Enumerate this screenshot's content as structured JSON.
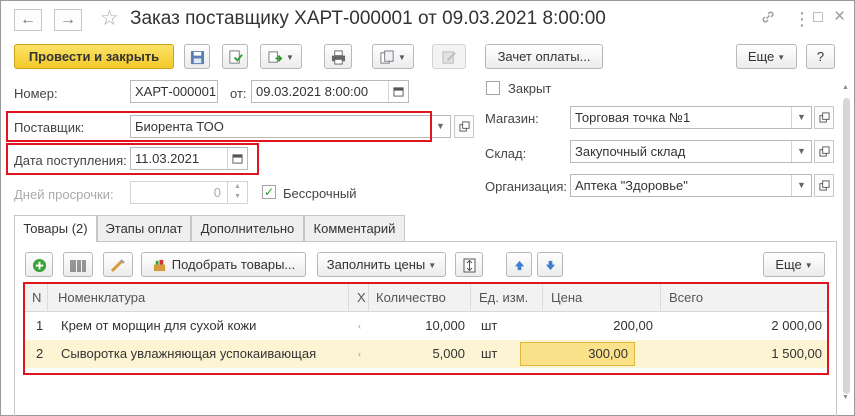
{
  "window": {
    "title": "Заказ поставщику ХАРТ-000001 от 09.03.2021 8:00:00",
    "back_glyph": "←",
    "forward_glyph": "→",
    "star_glyph": "☆",
    "link_glyph": "🔗",
    "menu_glyph": "⋮",
    "maximize_glyph": "□",
    "close_glyph": "×"
  },
  "toolbar": {
    "post_close_label": "Провести и закрыть",
    "payment_offset_label": "Зачет оплаты...",
    "more_label": "Еще",
    "help_label": "?"
  },
  "form": {
    "number_label": "Номер:",
    "number_value": "ХАРТ-000001",
    "date_from_label": "от:",
    "date_value": "09.03.2021  8:00:00",
    "supplier_label": "Поставщик:",
    "supplier_value": "Биорента ТОО",
    "arrival_label": "Дата поступления:",
    "arrival_value": "11.03.2021",
    "overdue_label": "Дней просрочки:",
    "overdue_value": "0",
    "unlimited_label": "Бессрочный",
    "unlimited_checked": true,
    "closed_label": "Закрыт",
    "closed_checked": false,
    "store_label": "Магазин:",
    "store_value": "Торговая точка №1",
    "warehouse_label": "Склад:",
    "warehouse_value": "Закупочный склад",
    "org_label": "Организация:",
    "org_value": "Аптека \"Здоровье\""
  },
  "tabs": [
    {
      "label": "Товары (2)",
      "active": true
    },
    {
      "label": "Этапы оплат",
      "active": false
    },
    {
      "label": "Дополнительно",
      "active": false
    },
    {
      "label": "Комментарий",
      "active": false
    }
  ],
  "table_toolbar": {
    "pick_label": "Подобрать товары...",
    "fill_prices_label": "Заполнить цены",
    "more_label": "Еще"
  },
  "table": {
    "columns": [
      "N",
      "Номенклатура",
      "Х",
      "Количество",
      "Ед. изм.",
      "Цена",
      "Всего"
    ],
    "rows": [
      {
        "n": "1",
        "name": "Крем от морщин для сухой кожи",
        "qty": "10,000",
        "unit": "шт",
        "price": "200,00",
        "total": "2 000,00"
      },
      {
        "n": "2",
        "name": "Сыворотка увлажняющая успокаивающая",
        "qty": "5,000",
        "unit": "шт",
        "price": "300,00",
        "total": "1 500,00"
      }
    ]
  },
  "colors": {
    "accent_yellow": "#f3c92a",
    "selected_row": "#fcf4d2",
    "edit_cell": "#fbe18a",
    "highlight_red": "#e0141c",
    "add_green": "#3aa23a",
    "arrow_blue": "#3f7fcf"
  }
}
